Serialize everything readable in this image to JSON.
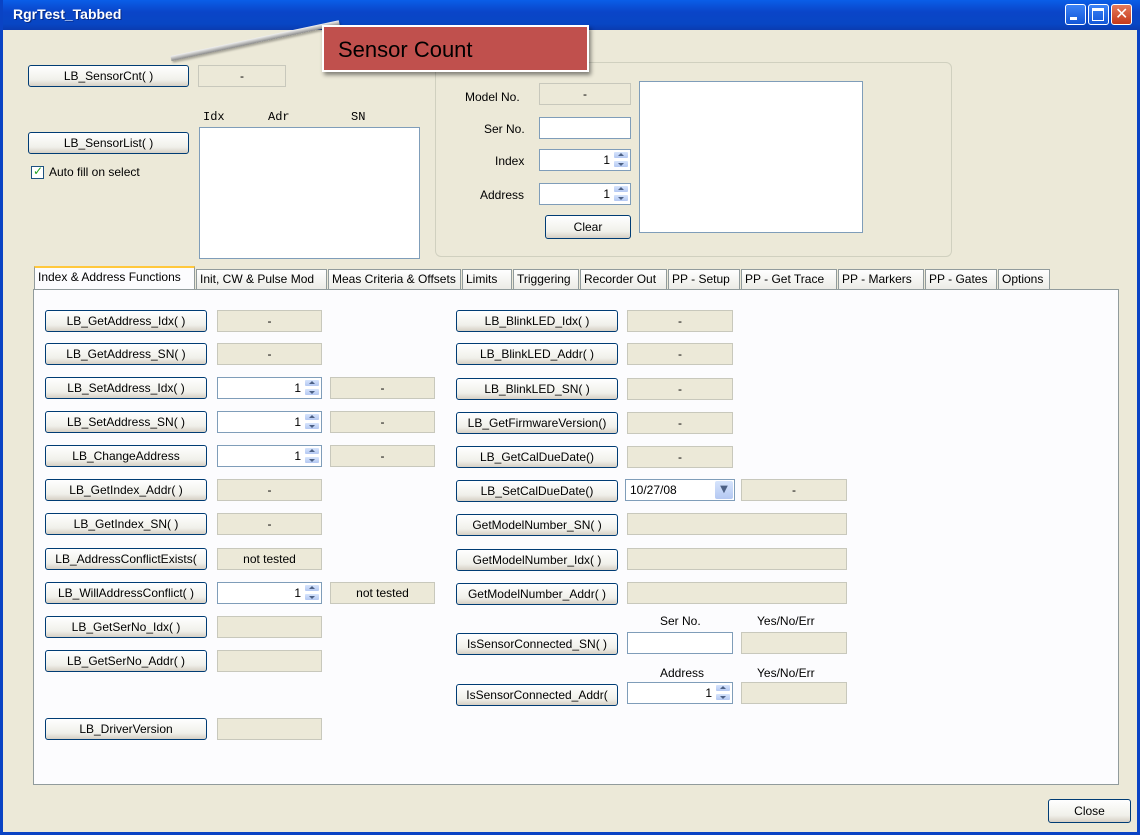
{
  "window": {
    "title": "RgrTest_Tabbed"
  },
  "callout": {
    "text": "Sensor Count"
  },
  "top": {
    "sensor_cnt_btn": "LB_SensorCnt( )",
    "sensor_cnt_val": "-",
    "sensor_list_btn": "LB_SensorList( )",
    "col_idx": "Idx",
    "col_adr": "Adr",
    "col_sn": "SN",
    "autofill_label": "Auto fill on select",
    "autofill_checked": true
  },
  "group": {
    "model_label": "Model No.",
    "model_val": "-",
    "ser_label": "Ser No.",
    "ser_val": "",
    "index_label": "Index",
    "index_val": "1",
    "address_label": "Address",
    "address_val": "1",
    "clear_btn": "Clear"
  },
  "tabs": [
    "Index & Address Functions",
    "Init, CW & Pulse Mod",
    "Meas Criteria & Offsets",
    "Limits",
    "Triggering",
    "Recorder Out",
    "PP - Setup",
    "PP - Get Trace",
    "PP - Markers",
    "PP - Gates",
    "Options"
  ],
  "left": {
    "get_addr_idx": {
      "label": "LB_GetAddress_Idx( )",
      "val": "-"
    },
    "get_addr_sn": {
      "label": "LB_GetAddress_SN( )",
      "val": "-"
    },
    "set_addr_idx": {
      "label": "LB_SetAddress_Idx( )",
      "spin": "1",
      "val": "-"
    },
    "set_addr_sn": {
      "label": "LB_SetAddress_SN( )",
      "spin": "1",
      "val": "-"
    },
    "change_addr": {
      "label": "LB_ChangeAddress",
      "spin": "1",
      "val": "-"
    },
    "get_idx_addr": {
      "label": "LB_GetIndex_Addr( )",
      "val": "-"
    },
    "get_idx_sn": {
      "label": "LB_GetIndex_SN( )",
      "val": "-"
    },
    "addr_conflict": {
      "label": "LB_AddressConflictExists(",
      "val": "not tested"
    },
    "will_conflict": {
      "label": "LB_WillAddressConflict( )",
      "spin": "1",
      "val": "not tested"
    },
    "get_ser_idx": {
      "label": "LB_GetSerNo_Idx( )",
      "val": ""
    },
    "get_ser_addr": {
      "label": "LB_GetSerNo_Addr( )",
      "val": ""
    },
    "driver_ver": {
      "label": "LB_DriverVersion",
      "val": ""
    }
  },
  "right": {
    "blink_idx": {
      "label": "LB_BlinkLED_Idx( )",
      "val": "-"
    },
    "blink_addr": {
      "label": "LB_BlinkLED_Addr( )",
      "val": "-"
    },
    "blink_sn": {
      "label": "LB_BlinkLED_SN( )",
      "val": "-"
    },
    "fw_ver": {
      "label": "LB_GetFirmwareVersion()",
      "val": "-"
    },
    "cal_due": {
      "label": "LB_GetCalDueDate()",
      "val": "-"
    },
    "set_cal": {
      "label": "LB_SetCalDueDate()",
      "date": "10/27/08",
      "val": "-"
    },
    "model_sn": {
      "label": "GetModelNumber_SN( )",
      "val": ""
    },
    "model_idx": {
      "label": "GetModelNumber_Idx( )",
      "val": ""
    },
    "model_addr": {
      "label": "GetModelNumber_Addr( )",
      "val": ""
    },
    "conn_sn": {
      "label": "IsSensorConnected_SN( )",
      "hdr1": "Ser No.",
      "hdr2": "Yes/No/Err",
      "input": "",
      "val": ""
    },
    "conn_addr": {
      "label": "IsSensorConnected_Addr(",
      "hdr1": "Address",
      "hdr2": "Yes/No/Err",
      "spin": "1",
      "val": ""
    }
  },
  "footer": {
    "close_btn": "Close"
  }
}
